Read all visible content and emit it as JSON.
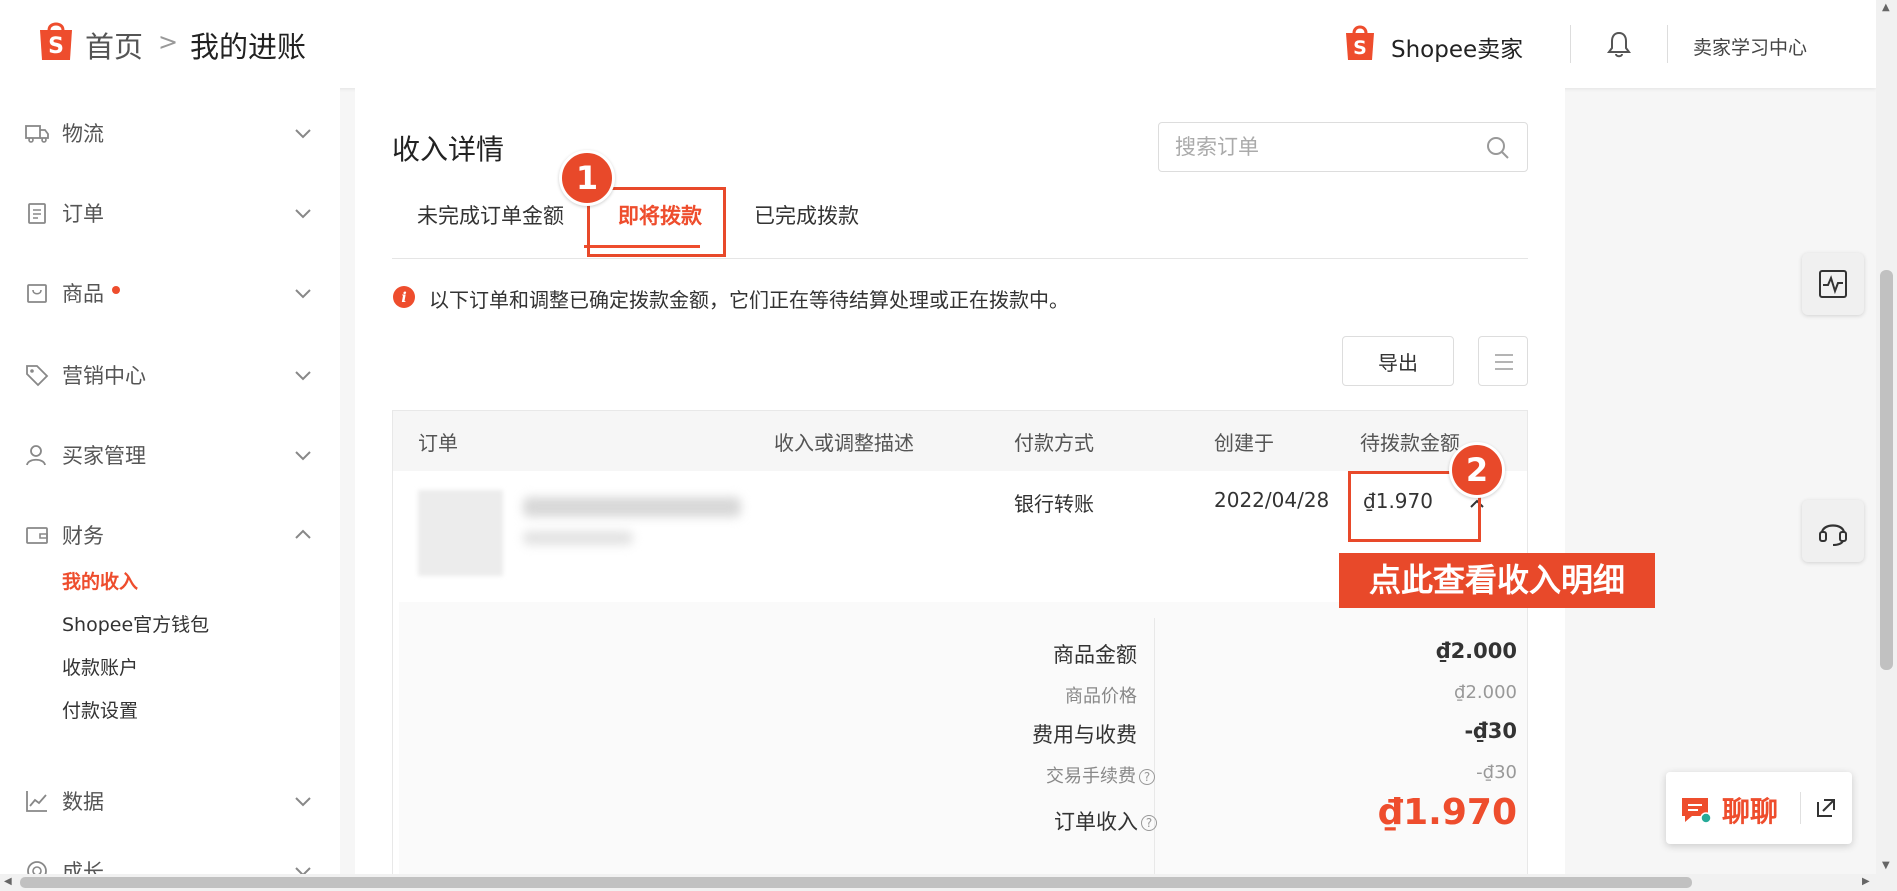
{
  "header": {
    "home": "首页",
    "separator": ">",
    "current": "我的进账",
    "seller_brand": "Shopee卖家",
    "learning_center": "卖家学习中心"
  },
  "sidebar": {
    "items": [
      {
        "label": "物流"
      },
      {
        "label": "订单"
      },
      {
        "label": "商品"
      },
      {
        "label": "营销中心"
      },
      {
        "label": "买家管理"
      },
      {
        "label": "财务"
      },
      {
        "label": "数据"
      },
      {
        "label": "成长"
      }
    ],
    "finance_sub": [
      {
        "label": "我的收入"
      },
      {
        "label": "Shopee官方钱包"
      },
      {
        "label": "收款账户"
      },
      {
        "label": "付款设置"
      }
    ]
  },
  "main": {
    "title": "收入详情",
    "search_placeholder": "搜索订单",
    "tabs": [
      {
        "label": "未完成订单金额"
      },
      {
        "label": "即将拨款"
      },
      {
        "label": "已完成拨款"
      }
    ],
    "notice": "以下订单和调整已确定拨款金额，它们正在等待结算处理或正在拨款中。",
    "export_label": "导出",
    "table": {
      "headers": [
        "订单",
        "收入或调整描述",
        "付款方式",
        "创建于",
        "待拨款金额"
      ],
      "row": {
        "payment_method": "银行转账",
        "created": "2022/04/28",
        "pending_amount": "₫1.970"
      },
      "detail": [
        {
          "label": "商品金额",
          "value": "₫2.000"
        },
        {
          "label": "商品价格",
          "value": "₫2.000"
        },
        {
          "label": "费用与收费",
          "value": "-₫30"
        },
        {
          "label": "交易手续费",
          "value": "-₫30"
        },
        {
          "label": "订单收入",
          "value": "₫1.970"
        }
      ]
    }
  },
  "annotations": {
    "step1": "1",
    "step2": "2",
    "callout": "点此查看收入明细"
  },
  "chat": {
    "label": "聊聊"
  },
  "colors": {
    "brand": "#ee4d2d",
    "annotation": "#e8492a"
  }
}
